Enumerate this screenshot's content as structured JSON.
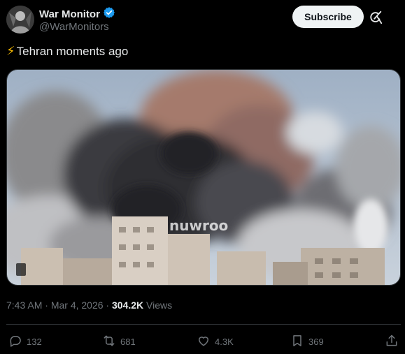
{
  "author": {
    "name": "War Monitor",
    "handle": "@WarMonitors",
    "verified": true,
    "verified_color": "#1d9bf0"
  },
  "header": {
    "subscribe_label": "Subscribe",
    "grok_icon": "grok-icon"
  },
  "tweet": {
    "emoji": "⚡",
    "text": "Tehran moments ago",
    "media_watermark": "nuwroo"
  },
  "meta": {
    "time": "7:43 AM",
    "sep1": " · ",
    "date": "Mar 4, 2026",
    "sep2": " · ",
    "views_count": "304.2K",
    "views_label": " Views"
  },
  "actions": {
    "replies": "132",
    "reposts": "681",
    "likes": "4.3K",
    "bookmarks": "369",
    "icons": [
      "reply-icon",
      "repost-icon",
      "like-icon",
      "bookmark-icon",
      "share-icon"
    ]
  },
  "colors": {
    "background": "#000000",
    "text": "#e7e9ea",
    "muted": "#71767b",
    "button_bg": "#eff3f4"
  }
}
